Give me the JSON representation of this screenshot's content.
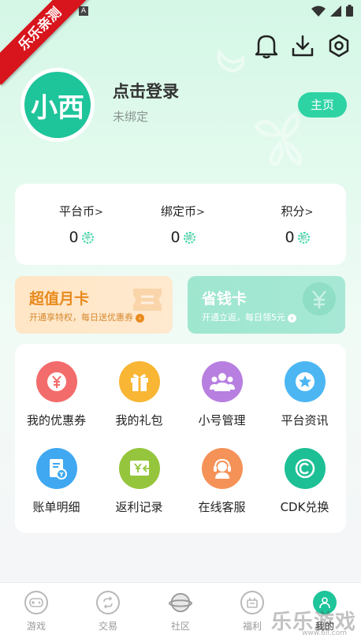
{
  "status_bar": {
    "app_badge": "A"
  },
  "ribbon": {
    "text": "乐乐亲测"
  },
  "profile": {
    "avatar_text": "小西",
    "title": "点击登录",
    "subtitle": "未绑定",
    "home_button": "主页"
  },
  "wallet": [
    {
      "label": "平台币",
      "value": "0",
      "badge": "平"
    },
    {
      "label": "绑定币",
      "value": "0",
      "badge": "绑"
    },
    {
      "label": "积分",
      "value": "0",
      "badge": "积"
    }
  ],
  "promos": {
    "monthly": {
      "title": "超值月卡",
      "subtitle": "开通享特权，每日送优惠券"
    },
    "saver": {
      "title": "省钱卡",
      "subtitle": "开通立返，每日领5元"
    }
  },
  "grid_items": [
    {
      "label": "我的优惠券",
      "icon": "coupon-icon",
      "color": "#f36c6c"
    },
    {
      "label": "我的礼包",
      "icon": "gift-icon",
      "color": "#f8b634"
    },
    {
      "label": "小号管理",
      "icon": "accounts-icon",
      "color": "#b77fe0"
    },
    {
      "label": "平台资讯",
      "icon": "star-icon",
      "color": "#4cb6f3"
    },
    {
      "label": "账单明细",
      "icon": "bill-icon",
      "color": "#3fa8f1"
    },
    {
      "label": "返利记录",
      "icon": "rebate-icon",
      "color": "#95c53c"
    },
    {
      "label": "在线客服",
      "icon": "headset-icon",
      "color": "#f59258"
    },
    {
      "label": "CDK兑换",
      "icon": "cdk-icon",
      "color": "#1dbf94"
    }
  ],
  "bottom_nav": [
    {
      "label": "游戏",
      "icon": "gamepad-icon"
    },
    {
      "label": "交易",
      "icon": "exchange-icon"
    },
    {
      "label": "社区",
      "icon": "planet-icon"
    },
    {
      "label": "福利",
      "icon": "welfare-icon"
    },
    {
      "label": "我的",
      "icon": "user-icon"
    }
  ],
  "watermark": {
    "text": "乐乐游戏",
    "url": "www.6ll.com"
  }
}
